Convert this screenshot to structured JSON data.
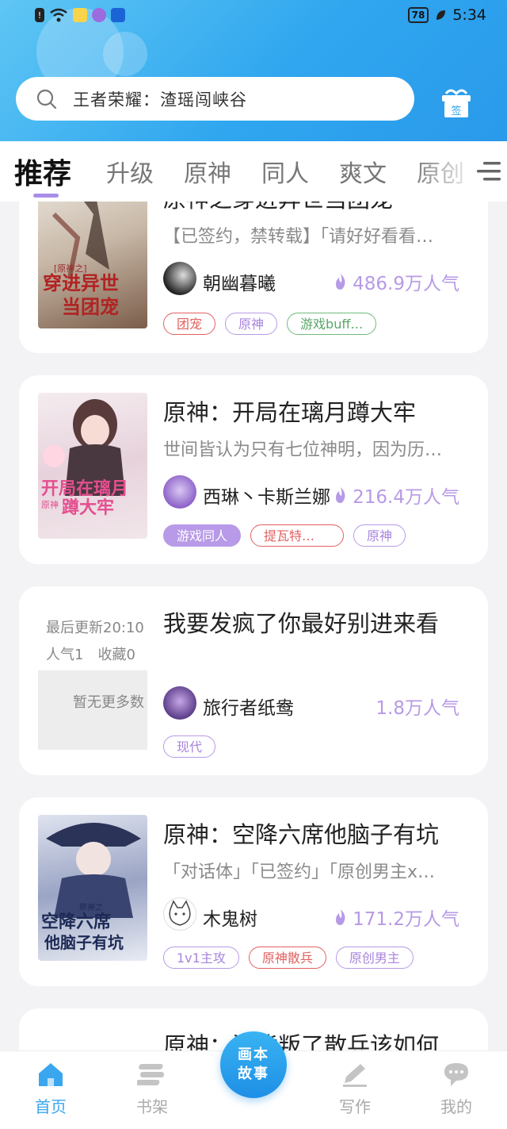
{
  "status_bar": {
    "time": "5:34",
    "battery": "78"
  },
  "search": {
    "placeholder_text": "王者荣耀：渣瑶闯峡谷"
  },
  "gift": {
    "label": "签"
  },
  "tabs": [
    {
      "label": "推荐",
      "active": true
    },
    {
      "label": "升级"
    },
    {
      "label": "原神"
    },
    {
      "label": "同人"
    },
    {
      "label": "爽文"
    },
    {
      "label": "原创"
    }
  ],
  "books": [
    {
      "title": "原神之穿进异世当团宠",
      "desc": "【已签约，禁转载】「请好好看看…",
      "author": "朝幽暮曦",
      "popularity": "486.9万人气",
      "cover_title_1": "穿进异世",
      "cover_title_2": "当团宠",
      "cover_sub": "[原神之]",
      "tags": [
        "团宠",
        "原神",
        "游戏buff…"
      ]
    },
    {
      "title": "原神：开局在璃月蹲大牢",
      "desc": "世间皆认为只有七位神明，因为历…",
      "author": "西琳丶卡斯兰娜",
      "popularity": "216.4万人气",
      "cover_title_1": "开局在璃月",
      "cover_title_2": "蹲大牢",
      "cover_sub": "原神",
      "tags": [
        "游戏同人",
        "提瓦特…",
        "原神"
      ]
    },
    {
      "title": "我要发疯了你最好别进来看",
      "author": "旅行者纸鸯",
      "popularity": "1.8万人气",
      "placeholder_line1": "最后更新20:10",
      "placeholder_line2": "人气1　收藏0",
      "placeholder_box": "暂无更多数",
      "tags": [
        "现代"
      ]
    },
    {
      "title": "原神：空降六席他脑子有坑",
      "desc": "「对话体」「已签约」「原创男主x…",
      "author": "木鬼树",
      "popularity": "171.2万人气",
      "cover_title_1": "空降六席",
      "cover_title_2": "他脑子有坑",
      "cover_sub": "原神之",
      "tags": [
        "1v1主攻",
        "原神散兵",
        "原创男主"
      ]
    },
    {
      "title": "原神：涅背叛了散兵该如何…"
    }
  ],
  "nav": {
    "home": "首页",
    "shelf": "书架",
    "center": "画本故事",
    "write": "写作",
    "mine": "我的"
  },
  "colors": {
    "accent_blue": "#2fa6ef",
    "accent_purple": "#b79ae6",
    "tag_red": "#e26060",
    "tag_green": "#5aa66a"
  }
}
